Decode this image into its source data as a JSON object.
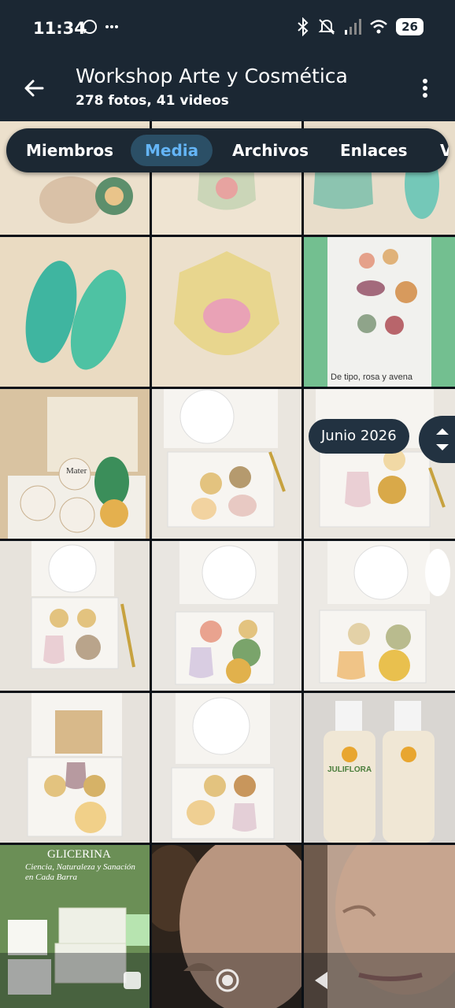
{
  "status": {
    "time": "11:34",
    "battery": "26"
  },
  "header": {
    "title": "Workshop Arte y Cosmética",
    "subtitle": "278 fotos, 41 videos"
  },
  "tabs": [
    {
      "label": "Miembros"
    },
    {
      "label": "Media"
    },
    {
      "label": "Archivos"
    },
    {
      "label": "Enlaces"
    },
    {
      "label": "V"
    }
  ],
  "date_label": "Junio 2026",
  "photos": {
    "caption_tile6": "De tipo, rosa y avena",
    "soap_label_top": "GLICERINA",
    "soap_label_sub": "Ciencia, Naturaleza y Sanación en Cada Barra",
    "bottle_brand": "JULIFLORA",
    "jar_brand": "Mater"
  },
  "colors": {
    "bar": "#1b2733",
    "accent": "#64b5f6",
    "active_tab_bg": "#2b4f66"
  }
}
